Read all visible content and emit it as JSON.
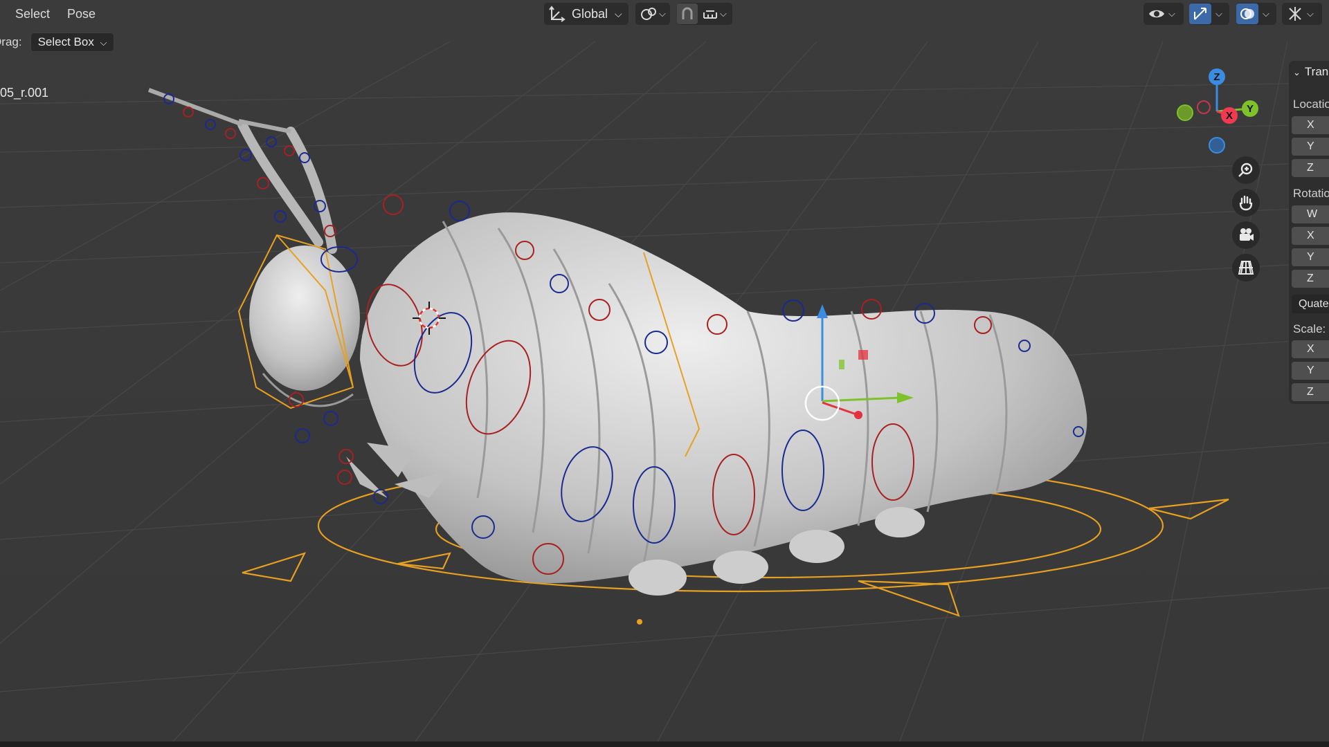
{
  "menu": {
    "select": "Select",
    "pose": "Pose"
  },
  "header": {
    "orientation": "Global",
    "icons": [
      "transform-orientation-icon",
      "pivot-icon",
      "snap-icon",
      "snap-increment-icon",
      "visibility-icon",
      "gizmo-icon",
      "overlays-icon",
      "bone-overlay-icon"
    ]
  },
  "tool_options": {
    "drag_label": "Drag:",
    "drag_value": "Select Box"
  },
  "object_name": "05_r.001",
  "gizmo": {
    "z": "Z",
    "y": "Y",
    "x": "X",
    "x_color": "#f03a52",
    "y_color": "#7ec12a",
    "z_color": "#3a8de0"
  },
  "sidebar": {
    "section": "Tran",
    "location_label": "Locatio",
    "location_fields": [
      "X",
      "Y",
      "Z"
    ],
    "rotation_label": "Rotatio",
    "rotation_fields": [
      "W",
      "X",
      "Y",
      "Z"
    ],
    "rotation_mode": "Quate",
    "scale_label": "Scale:",
    "scale_fields": [
      "X",
      "Y",
      "Z"
    ]
  },
  "colors": {
    "rig_orange": "#e8a020",
    "control_red": "#a82020",
    "control_blue": "#1a2a90",
    "body": "#c9c9c9"
  }
}
